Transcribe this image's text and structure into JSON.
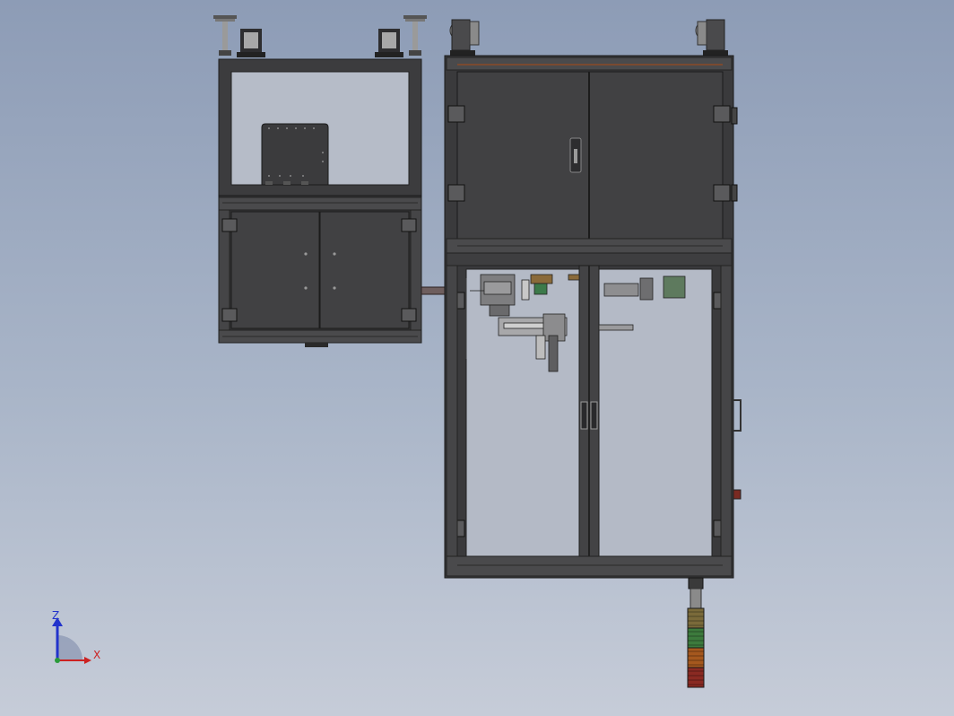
{
  "view": {
    "background_top": "#8d9cb6",
    "background_bottom": "#c6ccd8",
    "frame_color": "#3a3a3c",
    "panel_color": "#3f3f41",
    "glass_color": "#b4bac6"
  },
  "triad": {
    "z_label": "Z",
    "x_label": "X",
    "z_color": "#2233cc",
    "x_color": "#cc2222"
  },
  "stack_light": {
    "colors": [
      "#7a6a3a",
      "#3c7a3c",
      "#a5581e",
      "#8a2a22"
    ]
  }
}
